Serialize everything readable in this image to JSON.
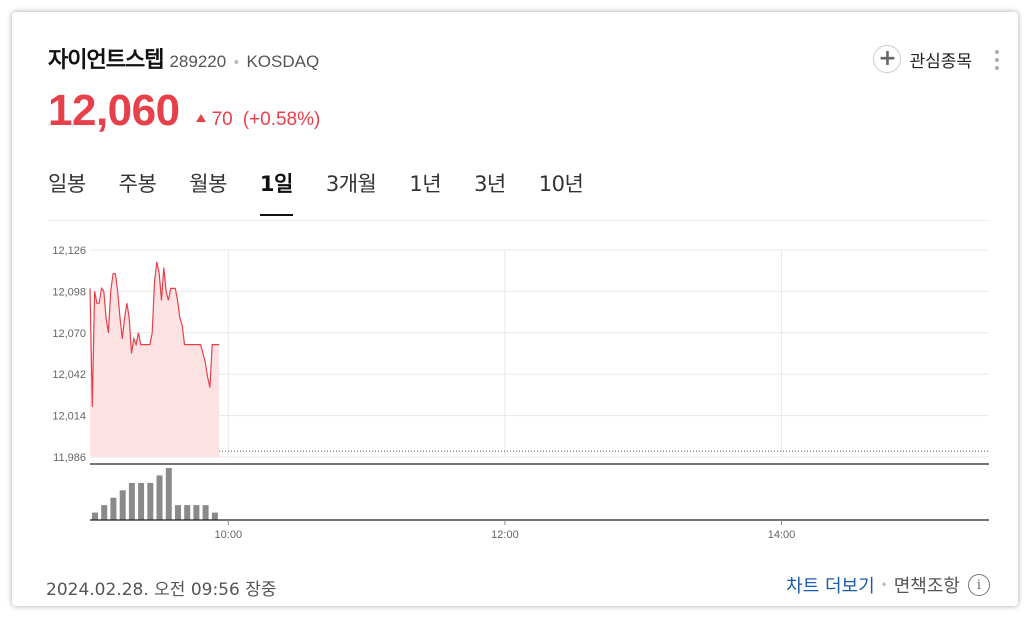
{
  "stock": {
    "name": "자이언트스텝",
    "code": "289220",
    "market": "KOSDAQ",
    "price": "12,060",
    "change": "70",
    "change_pct": "(+0.58%)",
    "direction": "up"
  },
  "actions": {
    "watch_label": "관심종목"
  },
  "tabs": [
    {
      "label": "일봉",
      "active": false
    },
    {
      "label": "주봉",
      "active": false
    },
    {
      "label": "월봉",
      "active": false
    },
    {
      "label": "1일",
      "active": true
    },
    {
      "label": "3개월",
      "active": false
    },
    {
      "label": "1년",
      "active": false
    },
    {
      "label": "3년",
      "active": false
    },
    {
      "label": "10년",
      "active": false
    }
  ],
  "footer": {
    "timestamp": "2024.02.28. 오전 09:56 장중",
    "more_chart": "차트 더보기",
    "disclaimer": "면책조항"
  },
  "colors": {
    "up": "#e8404b",
    "area_fill": "#fde2e3",
    "link": "#1a5ea8"
  },
  "chart_data": {
    "type": "area",
    "series": [
      {
        "x": [
          "09:00",
          "09:01",
          "09:02",
          "09:03",
          "09:04",
          "09:05",
          "09:06",
          "09:07",
          "09:08",
          "09:09",
          "09:10",
          "09:11",
          "09:12",
          "09:13",
          "09:14",
          "09:15",
          "09:16",
          "09:17",
          "09:18",
          "09:19",
          "09:20",
          "09:21",
          "09:22",
          "09:23",
          "09:24",
          "09:25",
          "09:26",
          "09:27",
          "09:28",
          "09:29",
          "09:30",
          "09:31",
          "09:32",
          "09:33",
          "09:34",
          "09:35",
          "09:36",
          "09:37",
          "09:38",
          "09:39",
          "09:40",
          "09:41",
          "09:42",
          "09:43",
          "09:44",
          "09:45",
          "09:46",
          "09:47",
          "09:48",
          "09:49",
          "09:50",
          "09:51",
          "09:52",
          "09:53",
          "09:54",
          "09:55",
          "09:56"
        ],
        "values": [
          12100,
          12020,
          12098,
          12090,
          12090,
          12100,
          12098,
          12080,
          12070,
          12098,
          12110,
          12110,
          12098,
          12080,
          12066,
          12080,
          12090,
          12080,
          12056,
          12066,
          12062,
          12070,
          12062,
          12062,
          12062,
          12062,
          12062,
          12070,
          12104,
          12118,
          12110,
          12092,
          12114,
          12098,
          12092,
          12100,
          12100,
          12100,
          12092,
          12080,
          12075,
          12062,
          12062,
          12062,
          12062,
          12062,
          12062,
          12062,
          12062,
          12056,
          12050,
          12040,
          12033,
          12062,
          12062,
          12062,
          12062
        ]
      }
    ],
    "volume": [
      1,
      2,
      3,
      4,
      5,
      5,
      5,
      6,
      7,
      2,
      2,
      2,
      2,
      1
    ],
    "y_ticks": [
      "12,126",
      "12,098",
      "12,070",
      "12,042",
      "12,014",
      "11,986"
    ],
    "x_ticks": [
      "10:00",
      "12:00",
      "14:00"
    ],
    "ylim": [
      11986,
      12126
    ],
    "x_range": [
      "09:00",
      "15:30"
    ],
    "baseline": 11990,
    "grid": true
  }
}
